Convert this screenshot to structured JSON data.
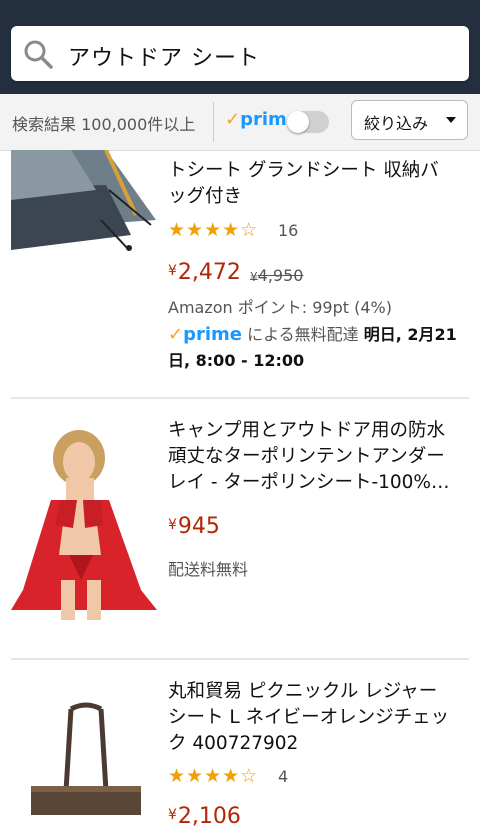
{
  "search": {
    "query": "アウトドア シート"
  },
  "filterbar": {
    "result_count": "検索結果 100,000件以上",
    "prime_label": "prime",
    "prime_check": "✓",
    "refine_label": "絞り込み"
  },
  "items": [
    {
      "title_line1": "トシート グランドシート 収納バ",
      "title_line2": "ッグ付き",
      "stars": "★★★★☆",
      "review_count": "16",
      "price": "2,472",
      "list_price": "4,950",
      "points": "Amazon ポイント: 99pt (4%)",
      "prime_label": "prime",
      "delivery_text": "による無料配達",
      "delivery_date": "明日, 2月21",
      "delivery_time": "日, 8:00 - 12:00"
    },
    {
      "title_line1": "キャンプ用とアウトドア用の防水",
      "title_line2": "頑丈なターポリンテントアンダー",
      "title_line3": "レイ - ターポリンシート-100%…",
      "price": "945",
      "shipping": "配送料無料"
    },
    {
      "title_line1": "丸和貿易 ピクニックル レジャー",
      "title_line2": "シート L ネイビーオレンジチェッ",
      "title_line3": "ク 400727902",
      "stars": "★★★★☆",
      "review_count": "4",
      "price": "2,106"
    }
  ],
  "currency": "¥",
  "colors": {
    "header": "#232f3e",
    "price": "#b12704",
    "prime": "#1a98ff",
    "star": "#f2a100"
  }
}
